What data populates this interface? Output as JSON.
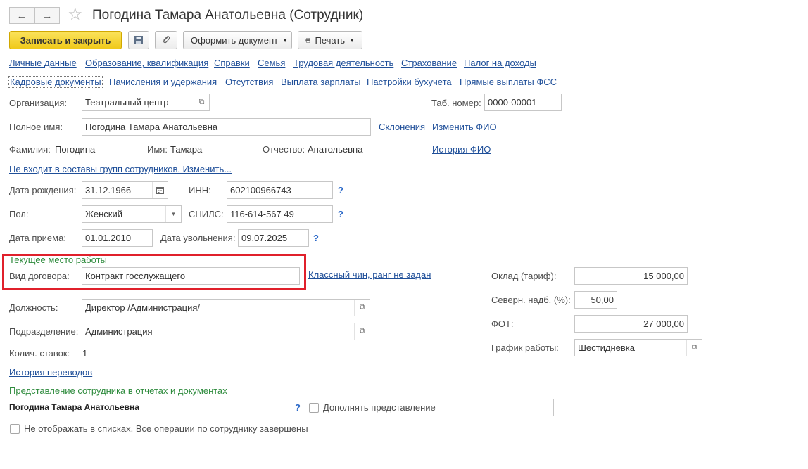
{
  "header": {
    "title": "Погодина Тамара Анатольевна (Сотрудник)",
    "back_icon": "←",
    "forward_icon": "→",
    "star_icon": "☆"
  },
  "toolbar": {
    "save_close": "Записать и закрыть",
    "save_icon": "floppy-icon",
    "attach_icon": "paperclip-icon",
    "make_doc": "Оформить документ",
    "print": "Печать"
  },
  "tabs_row1": [
    "Личные данные",
    "Образование, квалификация",
    "Справки",
    "Семья",
    "Трудовая деятельность",
    "Страхование",
    "Налог на доходы"
  ],
  "tabs_row2": [
    "Кадровые документы",
    "Начисления и удержания",
    "Отсутствия",
    "Выплата зарплаты",
    "Настройки бухучета",
    "Прямые выплаты ФСС"
  ],
  "form": {
    "org_label": "Организация:",
    "org_value": "Театральный центр",
    "tab_num_label": "Таб. номер:",
    "tab_num_value": "0000-00001",
    "full_name_label": "Полное имя:",
    "full_name_value": "Погодина Тамара Анатольевна",
    "declensions_link": "Склонения",
    "change_fio_link": "Изменить ФИО",
    "surname_label": "Фамилия:",
    "surname_value": "Погодина",
    "name_label": "Имя:",
    "name_value": "Тамара",
    "patronymic_label": "Отчество:",
    "patronymic_value": "Анатольевна",
    "history_fio_link": "История ФИО",
    "groups_link": "Не входит в составы групп сотрудников. Изменить...",
    "birth_label": "Дата рождения:",
    "birth_value": "31.12.1966",
    "inn_label": "ИНН:",
    "inn_value": "602100966743",
    "gender_label": "Пол:",
    "gender_value": "Женский",
    "snils_label": "СНИЛС:",
    "snils_value": "116-614-567 49",
    "hire_label": "Дата приема:",
    "hire_value": "01.01.2010",
    "dismiss_label": "Дата увольнения:",
    "dismiss_value": "09.07.2025",
    "help_mark": "?"
  },
  "workplace": {
    "section_title": "Текущее место работы",
    "contract_label": "Вид договора:",
    "contract_value": "Контракт госслужащего",
    "class_rank_link": "Классный чин, ранг не задан",
    "position_label": "Должность:",
    "position_value": "Директор /Администрация/",
    "dept_label": "Подразделение:",
    "dept_value": "Администрация",
    "rates_label": "Колич. ставок:",
    "rates_value": "1",
    "transfer_history_link": "История переводов",
    "salary_label": "Оклад (тариф):",
    "salary_value": "15 000,00",
    "north_label": "Северн. надб. (%):",
    "north_value": "50,00",
    "fot_label": "ФОТ:",
    "fot_value": "27 000,00",
    "schedule_label": "График работы:",
    "schedule_value": "Шестидневка"
  },
  "representation": {
    "section_title": "Представление сотрудника в отчетах и документах",
    "name_bold": "Погодина Тамара Анатольевна",
    "supplement_label": "Дополнять представление",
    "supplement_value": "",
    "hide_label": "Не отображать в списках. Все операции по сотруднику завершены"
  },
  "colors": {
    "accent_button": "#f5d22a",
    "highlight_frame": "#e0202b",
    "link": "#1f4f99",
    "section_green": "#2e8b3d"
  }
}
